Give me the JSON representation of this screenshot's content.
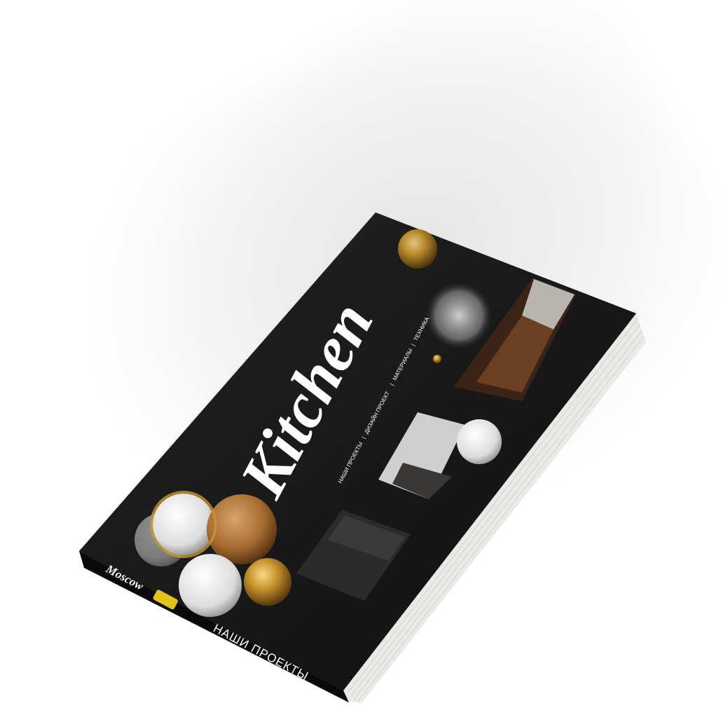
{
  "cover": {
    "title": "Kitchen",
    "nav": [
      "НАШИ ПРОЕКТЫ",
      "ДИЗАЙН ПРОЕКТ",
      "МАТЕРИАЛЫ",
      "ТЕХНИКА"
    ],
    "nav_separator": "|"
  },
  "spine": {
    "brand": "Moscow",
    "badge": "",
    "title": "НАШИ ПРОЕКТЫ"
  },
  "colors": {
    "cover": "#161616",
    "spine": "#0d0d0d",
    "pages": "#e9e9e6",
    "accent_gold": "#c9962e",
    "badge_yellow": "#e3c21b"
  },
  "icons": [
    "gold-sphere-icon",
    "marble-disc-icon",
    "wood-sphere-icon"
  ]
}
